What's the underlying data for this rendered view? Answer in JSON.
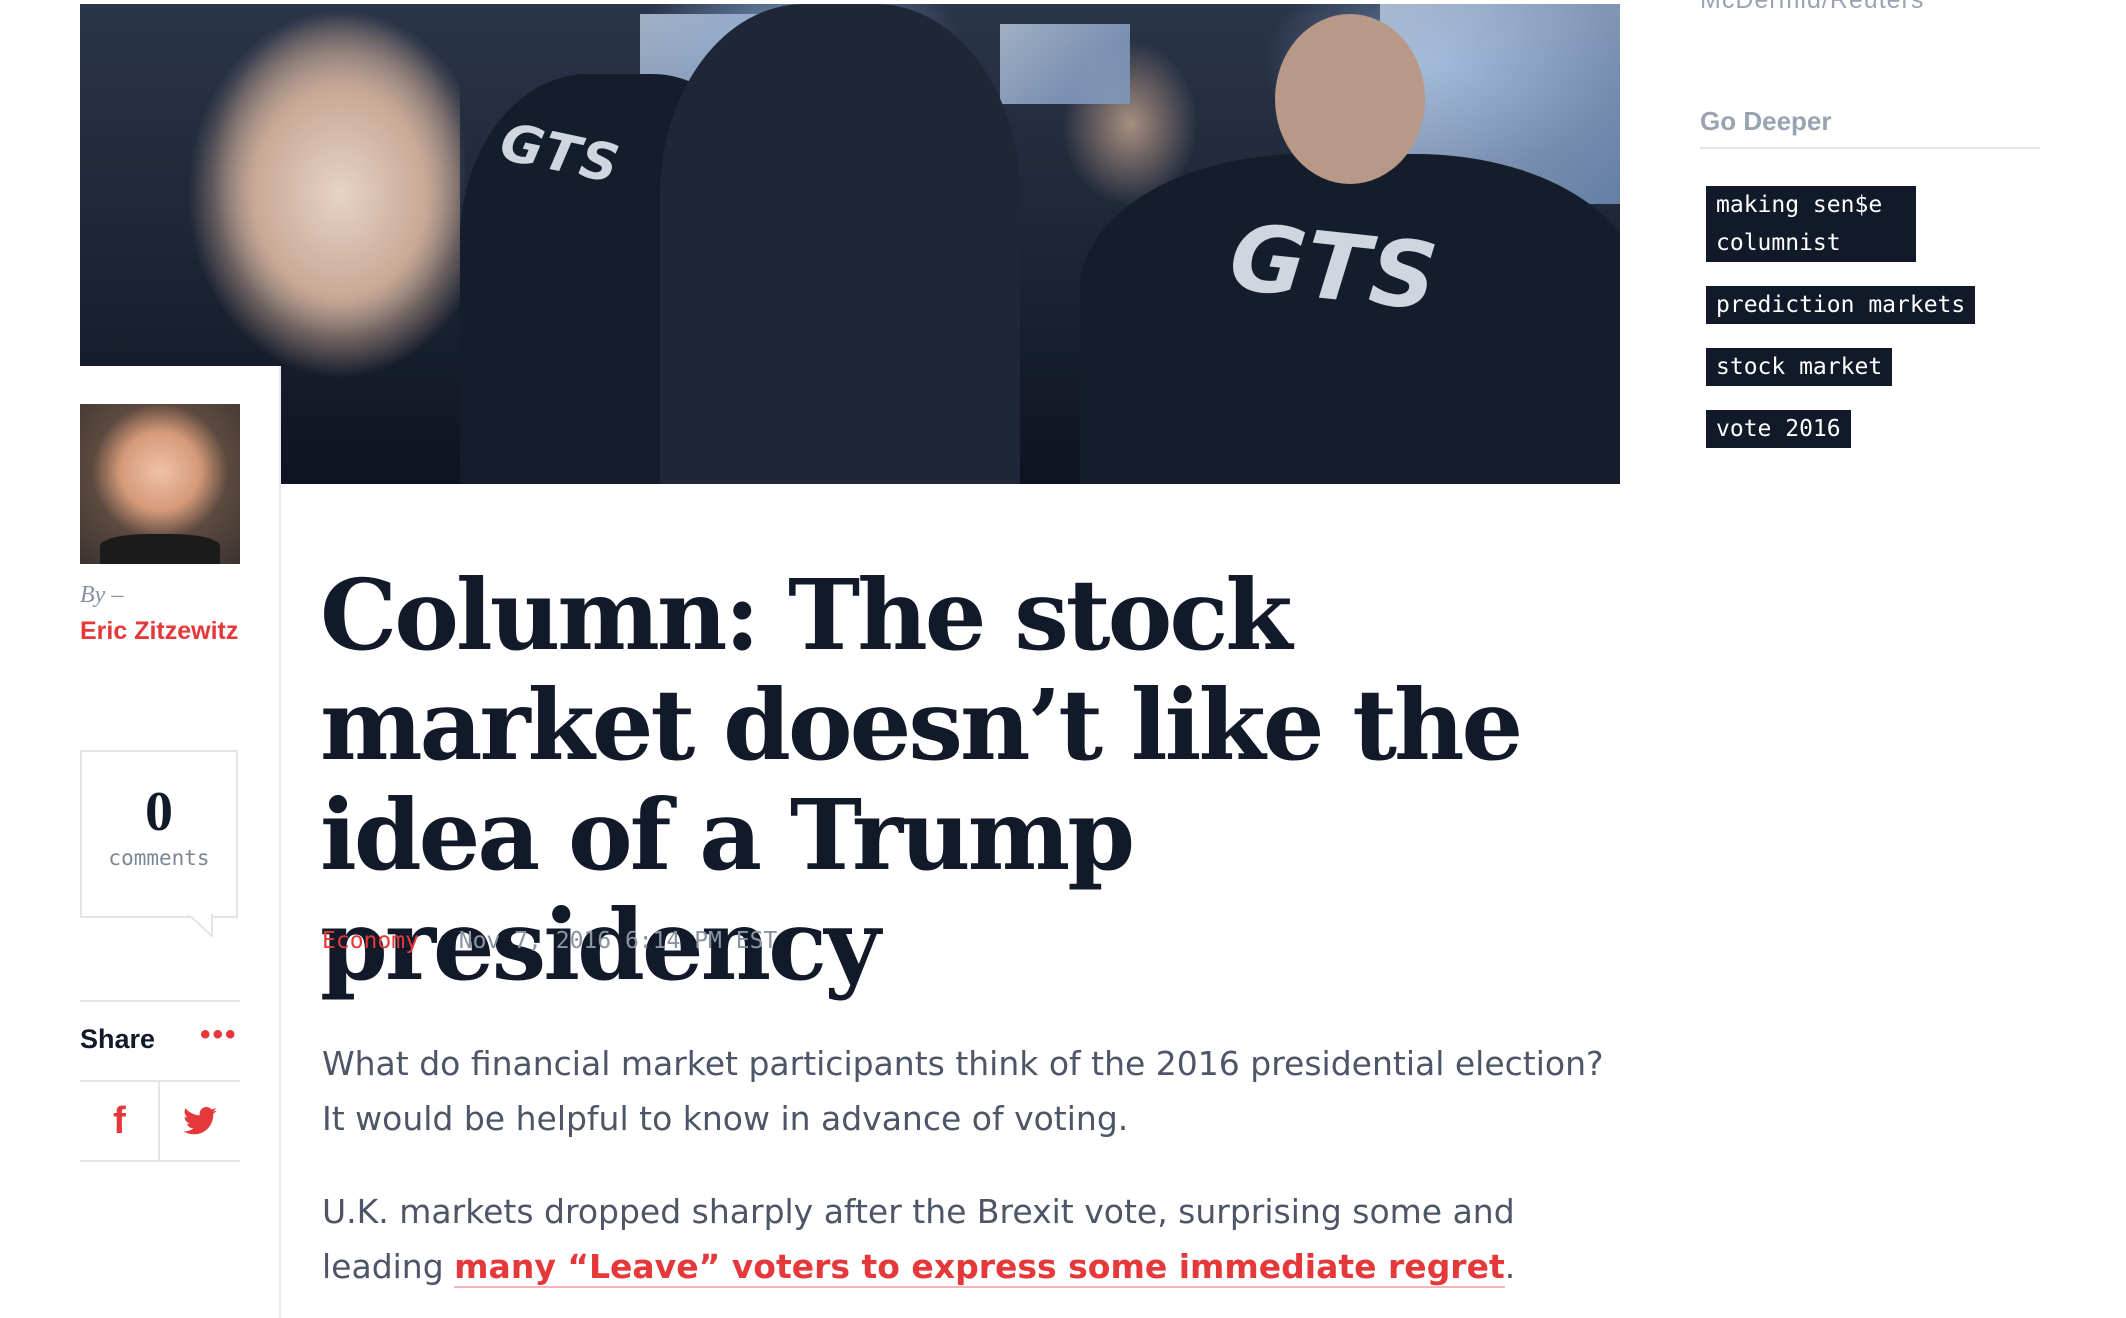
{
  "hero": {
    "credit": "McDermid/Reuters",
    "jacket_logo": "GTS"
  },
  "author": {
    "by_label": "By –",
    "name": "Eric Zitzewitz"
  },
  "comments": {
    "count": "0",
    "label": "comments"
  },
  "share": {
    "label": "Share",
    "more_label": "•••",
    "facebook": "f",
    "icons": [
      "facebook-icon",
      "twitter-icon",
      "more-icon"
    ]
  },
  "article": {
    "headline": "Column: The stock market doesn’t like the idea of a Trump presidency",
    "category": "Economy",
    "date": "Nov 7, 2016 6:14 PM EST",
    "para1": "What do financial market participants think of the 2016 presidential election? It would be helpful to know in advance of voting.",
    "para2_before": "U.K. markets dropped sharply after the Brexit vote, surprising some and leading ",
    "para2_link": "many “Leave” voters to express some immediate regret",
    "para2_after": "."
  },
  "sidebar": {
    "go_deeper": "Go Deeper",
    "tags": [
      "making sen$e columnist",
      "prediction markets",
      "stock market",
      "vote 2016"
    ]
  },
  "colors": {
    "accent": "#e5383b",
    "ink": "#121a2a",
    "muted": "#9aa3b1"
  }
}
